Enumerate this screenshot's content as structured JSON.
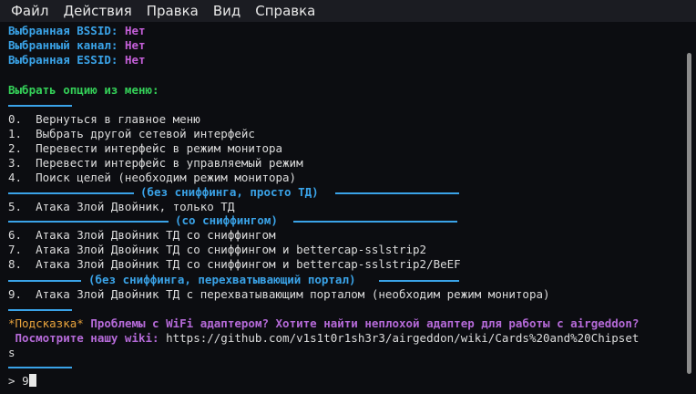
{
  "menubar": {
    "items": [
      "Файл",
      "Действия",
      "Правка",
      "Вид",
      "Справка"
    ]
  },
  "terminal": {
    "selected": [
      {
        "label": "Выбранная BSSID:",
        "value": "Нет"
      },
      {
        "label": "Выбранный канал:",
        "value": "Нет"
      },
      {
        "label": "Выбранная ESSID:",
        "value": "Нет"
      }
    ],
    "prompt_heading": "Выбрать опцию из меню:",
    "options_main": [
      "0.  Вернуться в главное меню",
      "1.  Выбрать другой сетевой интерфейс",
      "2.  Перевести интерфейс в режим монитора",
      "3.  Перевести интерфейс в управляемый режим",
      "4.  Поиск целей (необходим режим монитора)"
    ],
    "section1_label": "(без сниффинга, просто ТД)",
    "options_section1": [
      "5.  Атака Злой Двойник, только ТД"
    ],
    "section2_label": "(со сниффингом)",
    "options_section2": [
      "6.  Атака Злой Двойник ТД со сниффингом",
      "7.  Атака Злой Двойник ТД со сниффингом и bettercap-sslstrip2",
      "8.  Атака Злой Двойник ТД со сниффингом и bettercap-sslstrip2/BeEF"
    ],
    "section3_label": "(без сниффинга, перехватывающий портал)",
    "options_section3": [
      "9.  Атака Злой Двойник ТД с перехватывающим порталом (необходим режим монитора)"
    ],
    "hint_label": "*Подсказка*",
    "hint_text": " Проблемы с WiFi адаптером? Хотите найти неплохой адаптер для работы с airgeddon?",
    "wiki_label": " Посмотрите нашу wiki:",
    "wiki_url": " https://github.com/v1s1t0r1sh3r3/airgeddon/wiki/Cards%20and%20Chipset",
    "wiki_url_wrap": "s",
    "input_prompt": "> ",
    "input_value": "9"
  }
}
